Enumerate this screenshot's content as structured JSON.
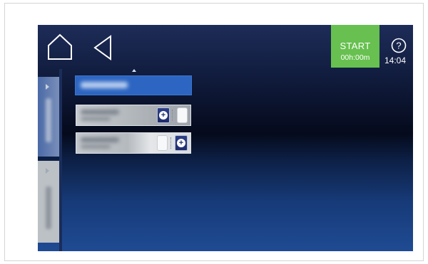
{
  "header": {
    "home_icon": "home-icon",
    "back_icon": "back-triangle-icon",
    "start": {
      "label": "START",
      "timer": "00h:00m",
      "color": "#67c04f"
    },
    "help_icon": "question-circle-icon",
    "clock": "14:04"
  },
  "screen": {
    "background_colors": [
      "#101b3c",
      "#050a1c",
      "#1f4b93"
    ],
    "accent": "#2d66c2"
  },
  "sidebar": {
    "tabs": [
      {
        "icon": "chevron-right-icon",
        "active": true
      },
      {
        "icon": "chevron-right-icon",
        "active": false
      }
    ]
  },
  "items": {
    "title_color": "#2d66c2",
    "rows": [
      {
        "add_icon": "plus-circle-icon",
        "toggle": "off"
      },
      {
        "add_icon": "plus-circle-icon",
        "toggle": "off"
      }
    ]
  }
}
